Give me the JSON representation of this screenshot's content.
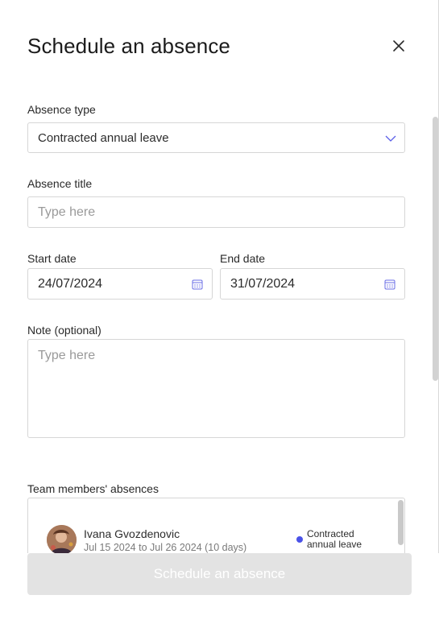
{
  "modal": {
    "title": "Schedule an absence",
    "close_icon": "close-icon"
  },
  "form": {
    "absence_type": {
      "label": "Absence type",
      "value": "Contracted annual leave"
    },
    "absence_title": {
      "label": "Absence title",
      "placeholder": "Type here"
    },
    "start_date": {
      "label": "Start date",
      "value": "24/07/2024"
    },
    "end_date": {
      "label": "End date",
      "value": "31/07/2024"
    },
    "note": {
      "label": "Note (optional)",
      "placeholder": "Type here"
    }
  },
  "team_absences": {
    "label": "Team members' absences",
    "items": [
      {
        "name": "Ivana Gvozdenovic",
        "dates": "Jul 15 2024 to Jul 26 2024 (10 days)",
        "type": "Contracted annual leave",
        "type_color": "#4a52e8"
      }
    ]
  },
  "footer": {
    "submit_label": "Schedule an absence"
  },
  "colors": {
    "accent": "#4a52e8",
    "disabled_button": "#e3e3e3",
    "border": "#d6d6d6"
  }
}
